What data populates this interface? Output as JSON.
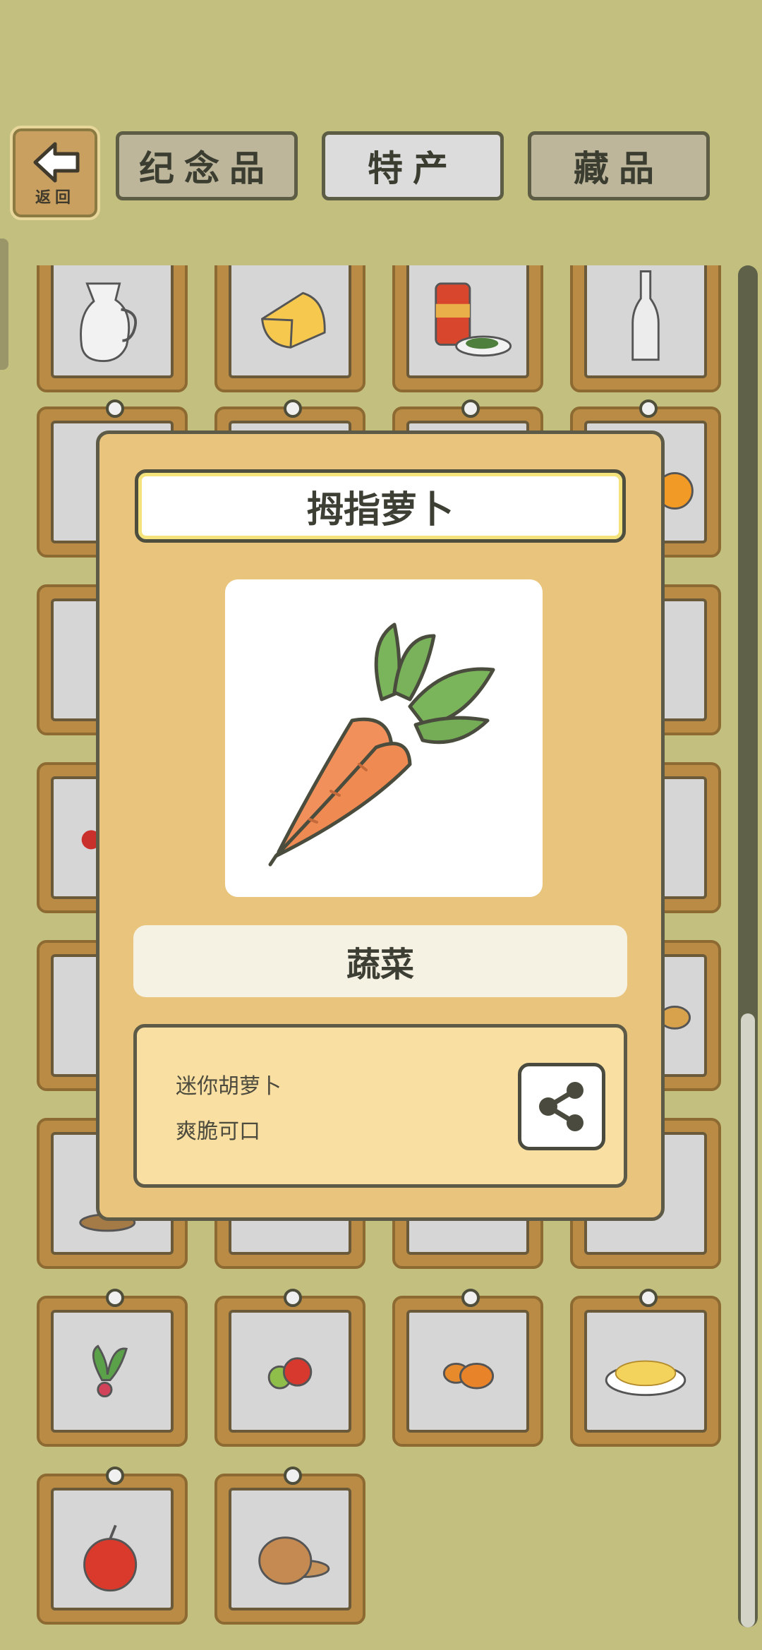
{
  "header": {
    "back_label": "返回",
    "tabs": [
      {
        "label": "纪念品",
        "state": "inactive"
      },
      {
        "label": "特产",
        "state": "active"
      },
      {
        "label": "藏品",
        "state": "inactive"
      }
    ]
  },
  "grid": {
    "items": [
      {
        "icon": "milk-jug-icon"
      },
      {
        "icon": "cheese-icon"
      },
      {
        "icon": "canned-tea-icon"
      },
      {
        "icon": "glass-bottle-icon"
      },
      {
        "icon": "specialty-item-icon"
      },
      {
        "icon": "specialty-item-icon"
      },
      {
        "icon": "specialty-item-icon"
      },
      {
        "icon": "orange-icon"
      },
      {
        "icon": "specialty-item-icon"
      },
      {
        "icon": "specialty-item-icon"
      },
      {
        "icon": "specialty-item-icon"
      },
      {
        "icon": "specialty-item-icon"
      },
      {
        "icon": "specialty-item-icon"
      },
      {
        "icon": "specialty-item-icon"
      },
      {
        "icon": "specialty-item-icon"
      },
      {
        "icon": "specialty-item-icon"
      },
      {
        "icon": "specialty-item-icon"
      },
      {
        "icon": "specialty-item-icon"
      },
      {
        "icon": "specialty-item-icon"
      },
      {
        "icon": "specialty-item-icon"
      },
      {
        "icon": "bread-icon"
      },
      {
        "icon": "specialty-item-icon"
      },
      {
        "icon": "specialty-item-icon"
      },
      {
        "icon": "specialty-item-icon"
      },
      {
        "icon": "radish-icon"
      },
      {
        "icon": "tomato-icon"
      },
      {
        "icon": "pumpkin-icon"
      },
      {
        "icon": "noodle-dish-icon"
      },
      {
        "icon": "apple-icon"
      },
      {
        "icon": "pancakes-icon"
      }
    ]
  },
  "modal": {
    "title": "拇指萝卜",
    "image_icon": "carrot-icon",
    "category": "蔬菜",
    "description": [
      "迷你胡萝卜",
      "爽脆可口"
    ],
    "share_icon": "share-icon"
  },
  "colors": {
    "background": "#c3bf7e",
    "modal": "#e8c47c",
    "desc_box": "#f9dfa1",
    "card_frame": "#b98b45"
  }
}
